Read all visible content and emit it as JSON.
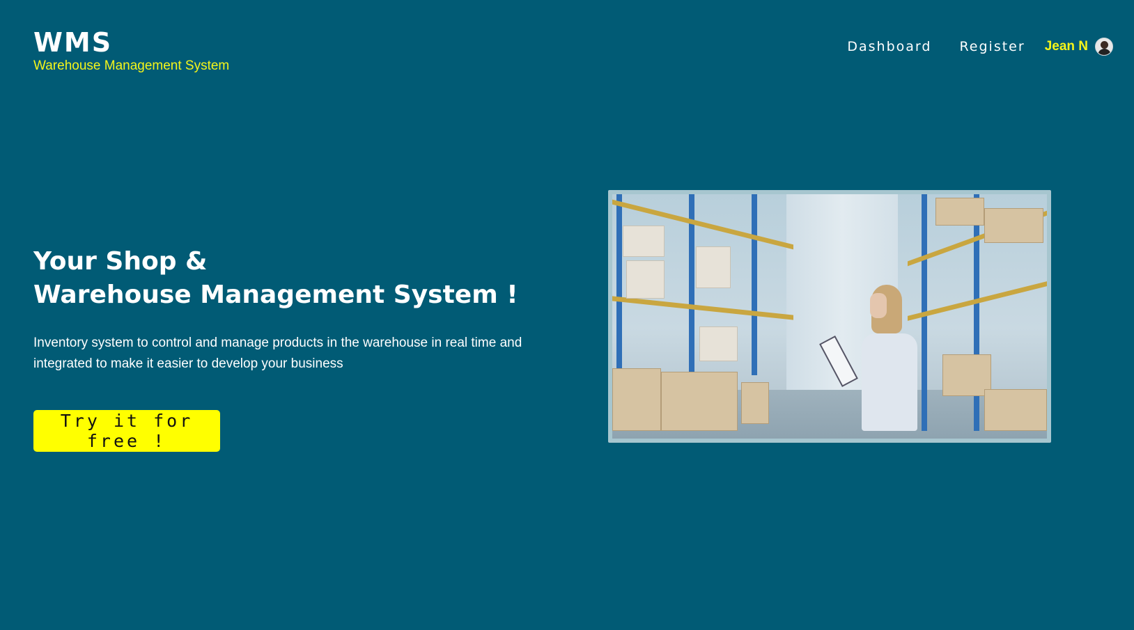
{
  "header": {
    "brand_title": "WMS",
    "brand_subtitle": "Warehouse Management System",
    "nav": {
      "dashboard_label": "Dashboard",
      "register_label": "Register",
      "user_name": "Jean N"
    }
  },
  "hero": {
    "title_line1": "Your Shop &",
    "title_line2": "Warehouse Management System !",
    "description": "Inventory system to control and manage products in the warehouse in real time and integrated to make it easier to develop your business",
    "cta_label": "Try it for free !"
  },
  "colors": {
    "background": "#015b75",
    "accent_yellow": "#ffff00",
    "subtitle_yellow": "#f5f51a",
    "image_frame": "#a7c6cf"
  },
  "icons": {
    "user_avatar": "avatar-icon"
  }
}
